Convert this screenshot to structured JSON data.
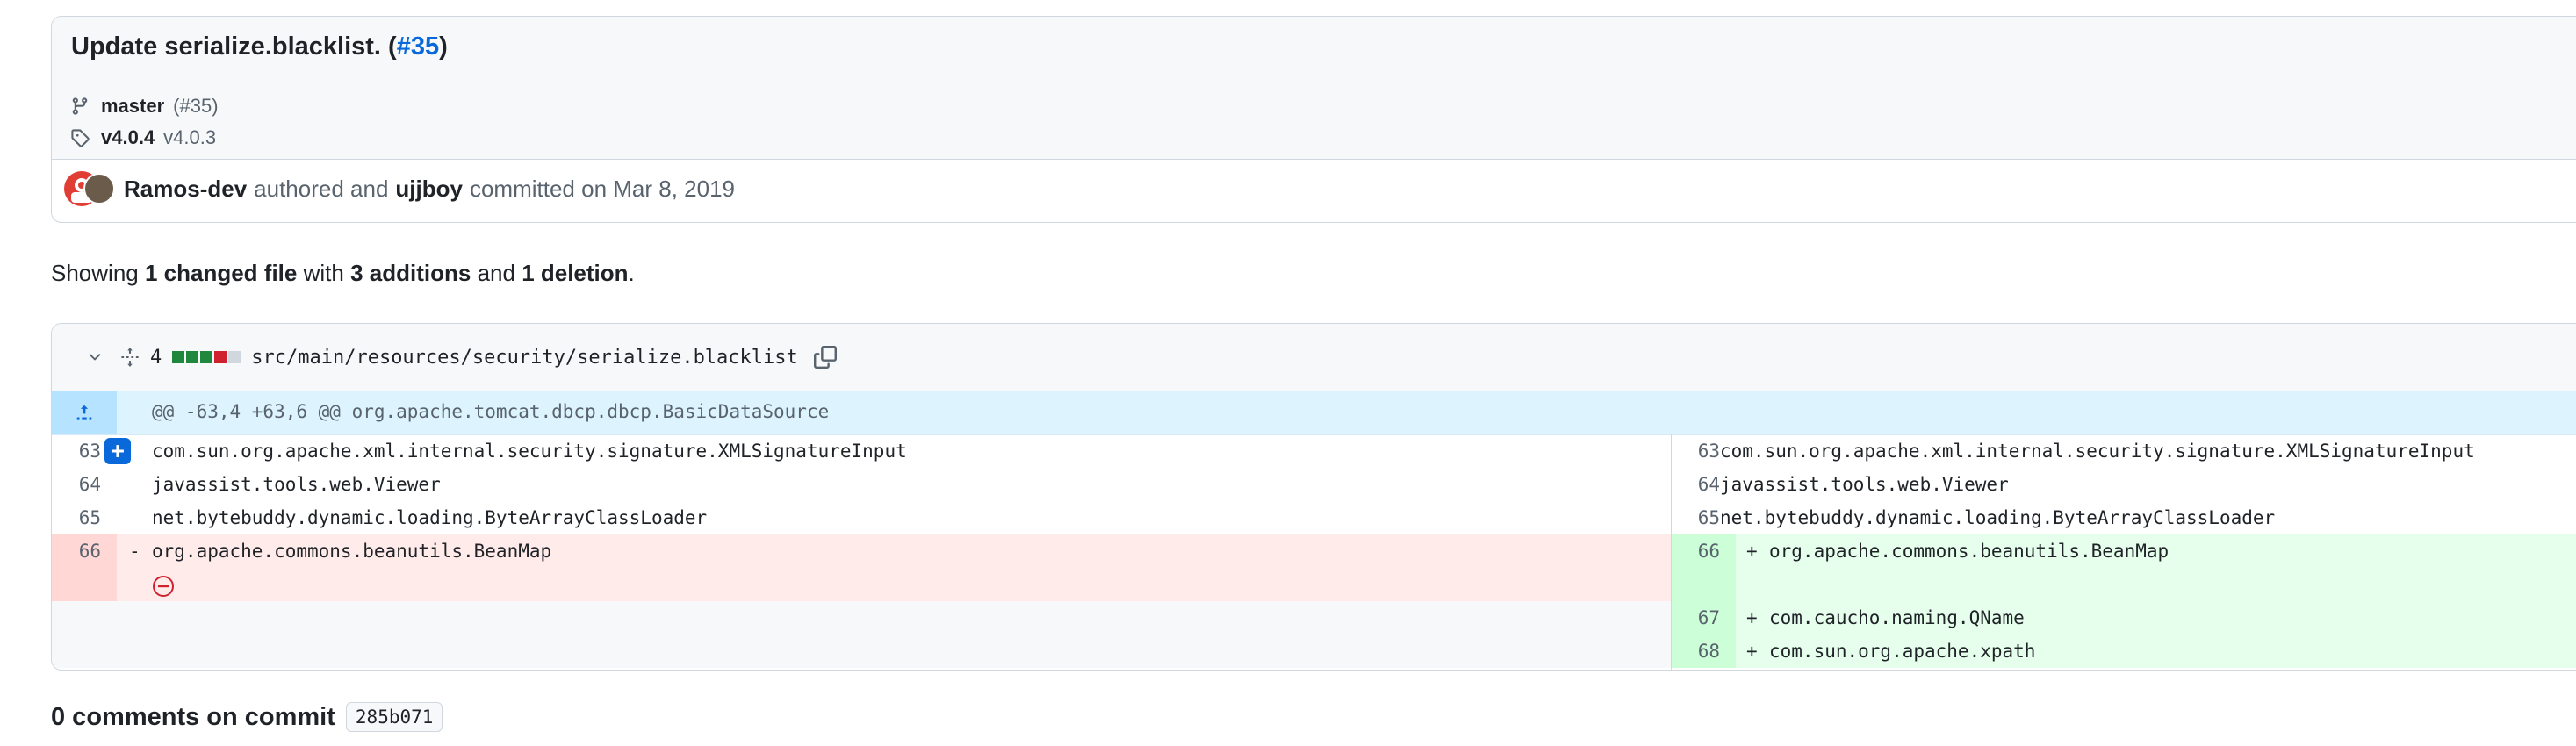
{
  "commit": {
    "title": "Update serialize.blacklist. (",
    "pr_link": "#35",
    "title_suffix": ")",
    "branch": {
      "name": "master",
      "ref": "(#35)"
    },
    "tags": {
      "primary": "v4.0.4",
      "secondary": "v4.0.3"
    },
    "author": "Ramos-dev",
    "authored_text": "authored and",
    "committer": "ujjboy",
    "committed_text": "committed on Mar 8, 2019"
  },
  "summary": {
    "prefix": "Showing",
    "files": "1 changed file",
    "with": "with",
    "additions": "3 additions",
    "and": "and",
    "deletions": "1 deletion",
    "end": "."
  },
  "file": {
    "change_count": "4",
    "path": "src/main/resources/security/serialize.blacklist",
    "diffstat_colors": [
      "#1f883d",
      "#1f883d",
      "#1f883d",
      "#cf222e",
      "#d0d7de"
    ]
  },
  "hunk": "@@ -63,4 +63,6 @@ org.apache.tomcat.dbcp.dbcp.BasicDataSource",
  "diff": {
    "context": [
      {
        "left_num": "63",
        "right_num": "63",
        "code": "com.sun.org.apache.xml.internal.security.signature.XMLSignatureInput"
      },
      {
        "left_num": "64",
        "right_num": "64",
        "code": "javassist.tools.web.Viewer"
      },
      {
        "left_num": "65",
        "right_num": "65",
        "code": "net.bytebuddy.dynamic.loading.ByteArrayClassLoader"
      }
    ],
    "deleted": {
      "num": "66",
      "sign": "-",
      "code": "org.apache.commons.beanutils.BeanMap"
    },
    "added": [
      {
        "num": "66",
        "sign": "+",
        "code": "org.apache.commons.beanutils.BeanMap"
      },
      {
        "num": "67",
        "sign": "+",
        "code": "com.caucho.naming.QName"
      },
      {
        "num": "68",
        "sign": "+",
        "code": "com.sun.org.apache.xpath"
      }
    ],
    "add_comment_label": "+"
  },
  "comments": {
    "label": "0 comments on commit",
    "sha": "285b071"
  },
  "colors": {
    "link": "#0969da",
    "add": "#e6ffec",
    "del": "#ffebe9",
    "hunk": "#ddf4ff"
  }
}
